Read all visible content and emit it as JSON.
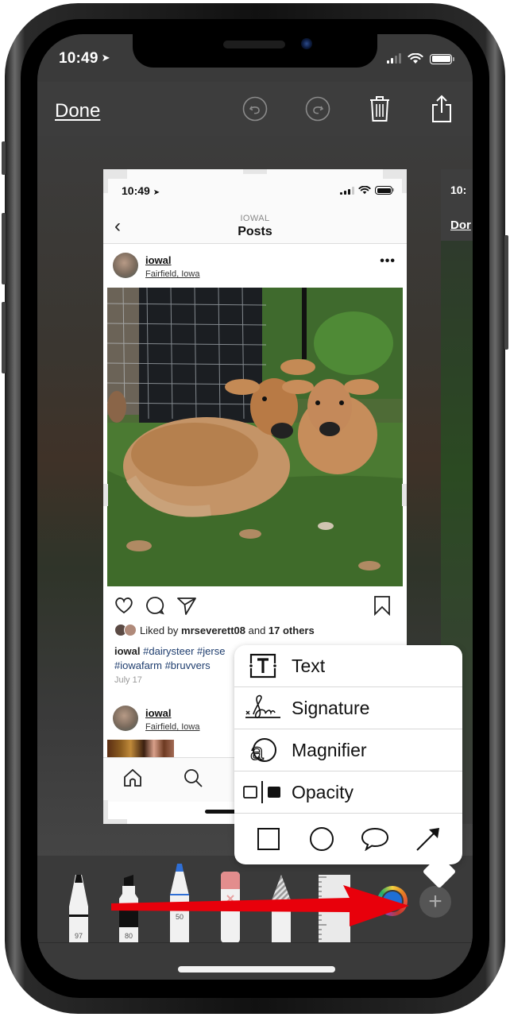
{
  "status_bar": {
    "time": "10:49",
    "location_icon": "location-arrow-icon",
    "signal_icon": "cellular-signal-icon",
    "wifi_icon": "wifi-icon",
    "battery_icon": "battery-icon"
  },
  "toolbar": {
    "done_label": "Done",
    "undo_icon": "undo-icon",
    "redo_icon": "redo-icon",
    "delete_icon": "trash-icon",
    "share_icon": "share-icon"
  },
  "screenshot": {
    "status_time": "10:49",
    "nav_subtitle": "IOWAL",
    "nav_title": "Posts",
    "post": {
      "username": "iowal",
      "location": "Fairfield, Iowa",
      "more_label": "•••",
      "liked_by_prefix": "Liked by ",
      "liked_by_user": "mrseverett08",
      "liked_by_mid": " and ",
      "liked_by_count": "17 others",
      "caption_user": "iowal",
      "caption_tags_line1": "#dairysteer #jerse",
      "caption_tags_line2": "#iowafarm #bruvvers",
      "date": "July 17"
    },
    "post2": {
      "username": "iowal",
      "location": "Fairfield, Iowa"
    }
  },
  "next_screenshot": {
    "time": "10:",
    "done_label": "Dor"
  },
  "markup_menu": {
    "items": [
      {
        "label": "Text",
        "icon": "text-box-icon"
      },
      {
        "label": "Signature",
        "icon": "signature-icon"
      },
      {
        "label": "Magnifier",
        "icon": "magnifier-icon"
      },
      {
        "label": "Opacity",
        "icon": "opacity-icon"
      }
    ],
    "shapes": [
      {
        "name": "square",
        "icon": "square-shape-icon"
      },
      {
        "name": "circle",
        "icon": "circle-shape-icon"
      },
      {
        "name": "speech-bubble",
        "icon": "speech-bubble-shape-icon"
      },
      {
        "name": "arrow",
        "icon": "arrow-shape-icon"
      }
    ]
  },
  "tools": {
    "pen_value": "97",
    "marker_value": "80",
    "pencil_value": "50",
    "pencil_color": "#2f6fd6",
    "selected_color": "#1f6fd6",
    "add_label": "+"
  },
  "annotation": {
    "arrow_color": "#e8000b"
  }
}
